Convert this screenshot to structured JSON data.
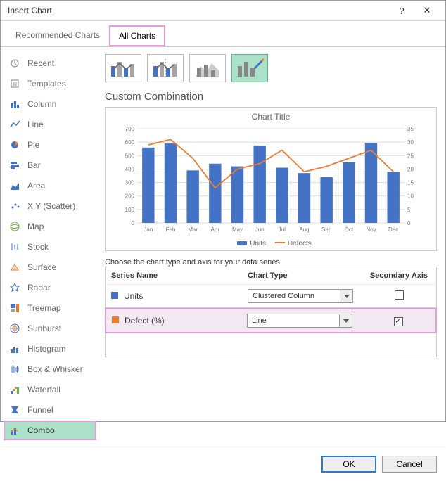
{
  "dialog": {
    "title": "Insert Chart"
  },
  "tabs": {
    "recommended": "Recommended Charts",
    "all": "All Charts"
  },
  "sidebar": {
    "items": [
      {
        "label": "Recent"
      },
      {
        "label": "Templates"
      },
      {
        "label": "Column"
      },
      {
        "label": "Line"
      },
      {
        "label": "Pie"
      },
      {
        "label": "Bar"
      },
      {
        "label": "Area"
      },
      {
        "label": "X Y (Scatter)"
      },
      {
        "label": "Map"
      },
      {
        "label": "Stock"
      },
      {
        "label": "Surface"
      },
      {
        "label": "Radar"
      },
      {
        "label": "Treemap"
      },
      {
        "label": "Sunburst"
      },
      {
        "label": "Histogram"
      },
      {
        "label": "Box & Whisker"
      },
      {
        "label": "Waterfall"
      },
      {
        "label": "Funnel"
      },
      {
        "label": "Combo"
      }
    ]
  },
  "section_title": "Custom Combination",
  "chart_preview_title": "Chart Title",
  "legend": {
    "s1": "Units",
    "s2": "Defects"
  },
  "config": {
    "instruction": "Choose the chart type and axis for your data series:",
    "headers": {
      "name": "Series Name",
      "type": "Chart Type",
      "axis": "Secondary Axis"
    },
    "rows": [
      {
        "name": "Units",
        "type": "Clustered Column",
        "secondary": false,
        "swatch": "#4472c4"
      },
      {
        "name": "Defect (%)",
        "type": "Line",
        "secondary": true,
        "swatch": "#ed7d31"
      }
    ]
  },
  "buttons": {
    "ok": "OK",
    "cancel": "Cancel"
  },
  "chart_data": {
    "type": "combo",
    "title": "Chart Title",
    "categories": [
      "Jan",
      "Feb",
      "Mar",
      "Apr",
      "May",
      "Jun",
      "Jul",
      "Aug",
      "Sep",
      "Oct",
      "Nov",
      "Dec"
    ],
    "series": [
      {
        "name": "Units",
        "type": "bar",
        "axis": "primary",
        "color": "#4472c4",
        "values": [
          560,
          590,
          390,
          440,
          420,
          575,
          410,
          370,
          340,
          450,
          595,
          380
        ]
      },
      {
        "name": "Defects",
        "type": "line",
        "axis": "secondary",
        "color": "#ed7d31",
        "values": [
          29,
          31,
          24,
          13,
          20,
          22,
          27,
          19,
          21,
          24,
          27,
          19
        ]
      }
    ],
    "y_primary": {
      "min": 0,
      "max": 700,
      "step": 100
    },
    "y_secondary": {
      "min": 0,
      "max": 35,
      "step": 5
    },
    "xlabel": "",
    "ylabel": ""
  }
}
